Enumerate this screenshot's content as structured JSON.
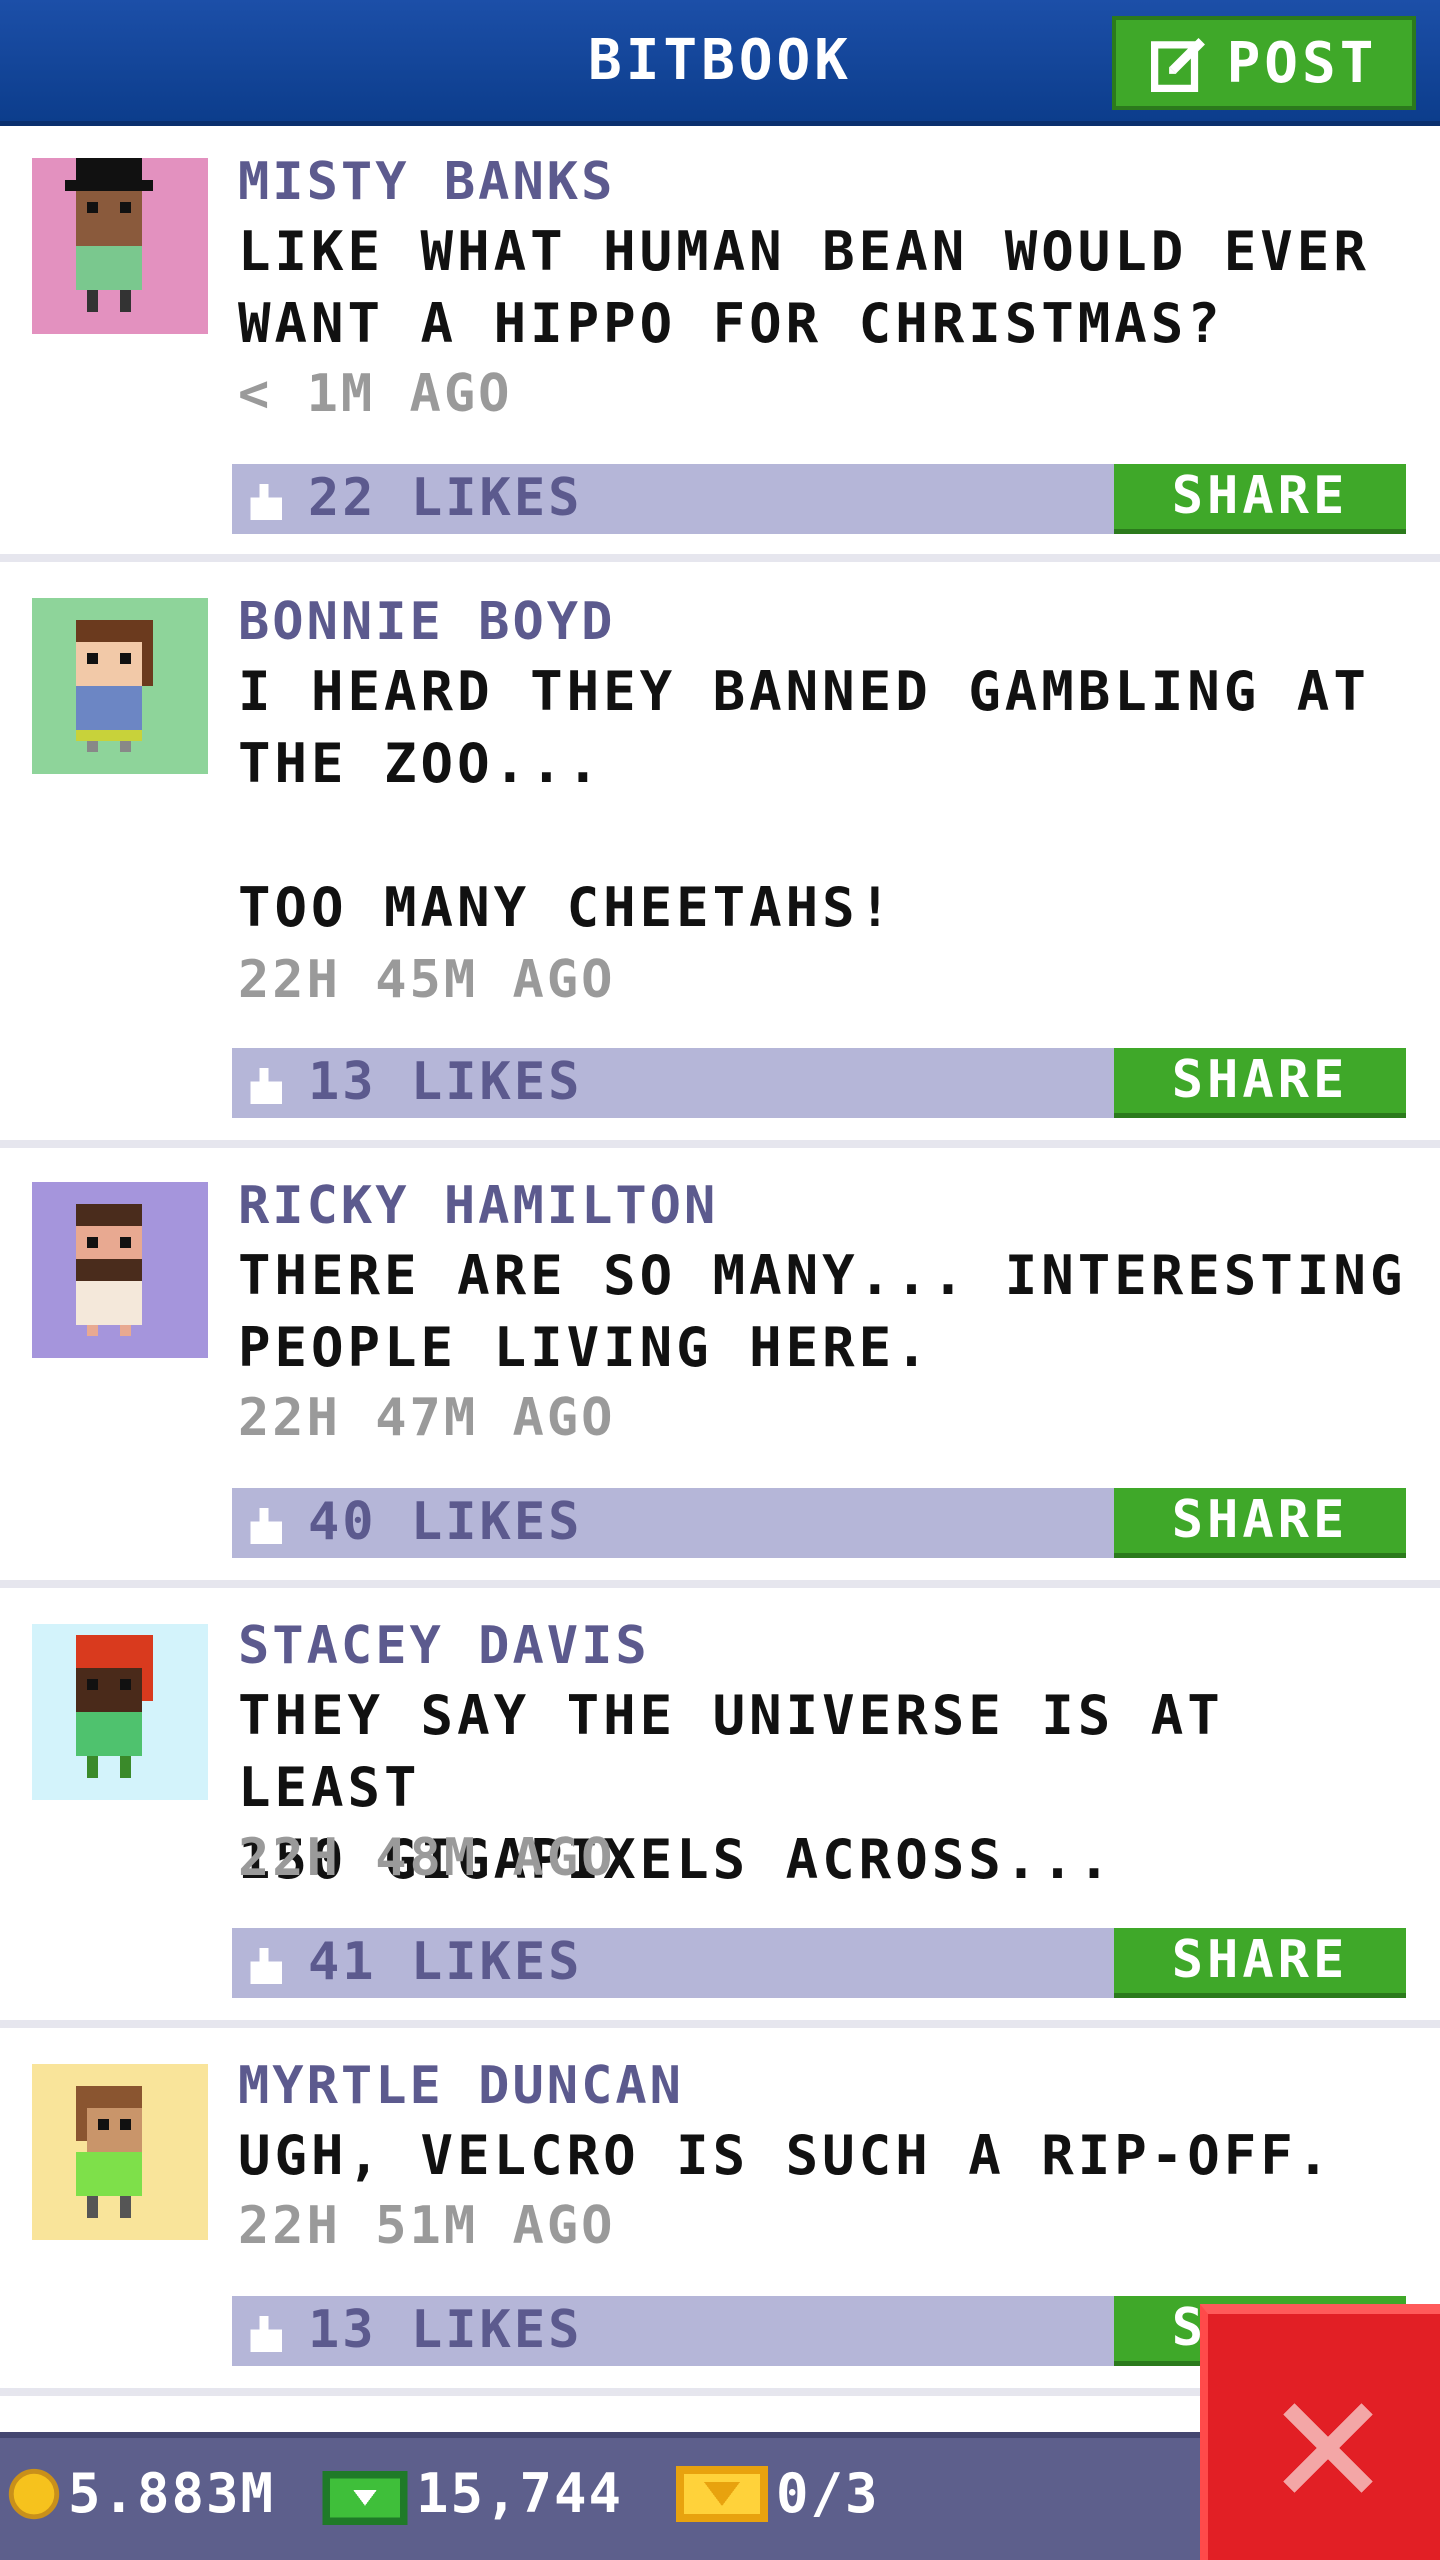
{
  "header": {
    "title": "BITBOOK",
    "post_label": "POST"
  },
  "posts": [
    {
      "author": "MISTY BANKS",
      "message": "LIKE WHAT HUMAN BEAN WOULD EVER\nWANT A HIPPO FOR CHRISTMAS?",
      "time": "< 1M AGO",
      "likes": "22 LIKES",
      "share": "SHARE",
      "avatar_bg": "#e391bf"
    },
    {
      "author": "BONNIE BOYD",
      "message": "I HEARD THEY BANNED GAMBLING AT\nTHE ZOO...\n\nTOO MANY CHEETAHS!",
      "time": "22H 45M AGO",
      "likes": "13 LIKES",
      "share": "SHARE",
      "avatar_bg": "#8ed49a"
    },
    {
      "author": "RICKY HAMILTON",
      "message": "THERE ARE SO MANY... INTERESTING\nPEOPLE LIVING HERE.",
      "time": "22H 47M AGO",
      "likes": "40 LIKES",
      "share": "SHARE",
      "avatar_bg": "#a595dc"
    },
    {
      "author": "STACEY DAVIS",
      "message": "THEY SAY THE UNIVERSE IS AT LEAST\n150 GIGAPIXELS ACROSS...",
      "time": "22H 48M AGO",
      "likes": "41 LIKES",
      "share": "SHARE",
      "avatar_bg": "#d3f3fb"
    },
    {
      "author": "MYRTLE DUNCAN",
      "message": "UGH, VELCRO IS SUCH A RIP-OFF.",
      "time": "22H 51M AGO",
      "likes": "13 LIKES",
      "share": "SHARE",
      "avatar_bg": "#f9e49a"
    }
  ],
  "status": {
    "coins": "5.883M",
    "bux": "15,744",
    "tickets": "0/3"
  },
  "colors": {
    "header_blue": "#0c3d8c",
    "green": "#3fa829",
    "likebar": "#b5b6d8",
    "name_purple": "#5c5a8e",
    "close_red": "#e21f25"
  }
}
